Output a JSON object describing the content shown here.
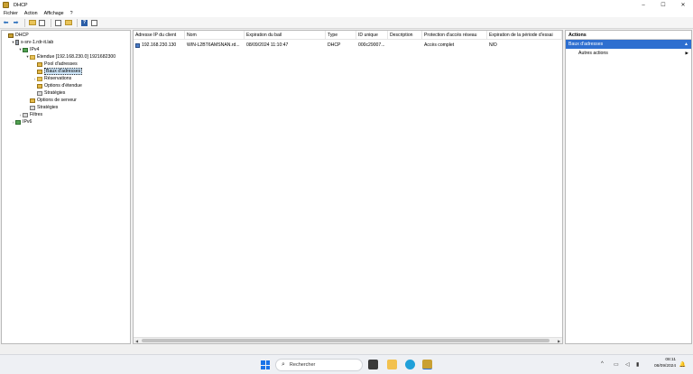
{
  "window": {
    "title": "DHCP",
    "controls": [
      "–",
      "☐",
      "✕"
    ]
  },
  "menu": [
    "Fichier",
    "Action",
    "Affichage",
    "?"
  ],
  "toolbar": {
    "icons": [
      "back-arrow-icon",
      "forward-arrow-icon",
      "up-folder-icon",
      "show-tree-icon",
      "refresh-icon",
      "export-icon",
      "help-icon",
      "properties-icon"
    ]
  },
  "tree": {
    "items": [
      {
        "label": "DHCP",
        "icon": "dhcp-icon",
        "twisty": ""
      },
      {
        "label": "s-srv-1.rdr-it.lab",
        "icon": "server-icon",
        "twisty": "▾"
      },
      {
        "label": "IPv4",
        "icon": "network-icon",
        "twisty": "▾"
      },
      {
        "label": "Étendue [192.168.230.0] 1921682300",
        "icon": "scope-folder-icon",
        "twisty": "▾"
      },
      {
        "label": "Pool d'adresses",
        "icon": "address-pool-icon",
        "twisty": ""
      },
      {
        "label": "Baux d'adresses",
        "icon": "address-leases-icon",
        "twisty": ""
      },
      {
        "label": "Réservations",
        "icon": "reservations-icon",
        "twisty": "›"
      },
      {
        "label": "Options d'étendue",
        "icon": "scope-options-icon",
        "twisty": ""
      },
      {
        "label": "Stratégies",
        "icon": "policies-icon",
        "twisty": ""
      },
      {
        "label": "Options de serveur",
        "icon": "server-options-icon",
        "twisty": ""
      },
      {
        "label": "Stratégies",
        "icon": "policies-icon",
        "twisty": ""
      },
      {
        "label": "Filtres",
        "icon": "filters-icon",
        "twisty": "›"
      },
      {
        "label": "IPv6",
        "icon": "network-icon",
        "twisty": "›"
      }
    ]
  },
  "table": {
    "columns": [
      "Adresse IP du client",
      "Nom",
      "Expiration du bail",
      "Type",
      "ID unique",
      "Description",
      "Protection d'accès réseau",
      "Expiration de la période d'essai"
    ],
    "rows": [
      [
        "192.168.230.130",
        "WIN-L2BT6AMSNAN.rd...",
        "08/09/2024 11:10:47",
        "DHCP",
        "000c29007...",
        "",
        "Accès complet",
        "N/D"
      ]
    ]
  },
  "actions": {
    "header": "Actions",
    "section": "Baux d'adresses",
    "items": [
      "Autres actions"
    ]
  },
  "taskbar": {
    "search_placeholder": "Rechercher",
    "time": "08:11",
    "date": "08/09/2024",
    "tray_icons": [
      "chevron-up-icon",
      "network-icon",
      "volume-icon",
      "battery-icon"
    ]
  },
  "colors": {
    "selection": "#2e6fd0",
    "start_blue": "#1a73e8"
  }
}
